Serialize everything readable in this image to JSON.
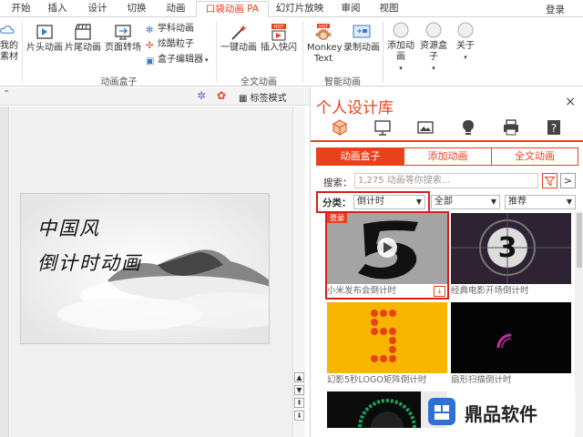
{
  "tabs": [
    "开始",
    "插入",
    "设计",
    "切换",
    "动画",
    "口袋动画 PA",
    "幻灯片放映",
    "审阅",
    "视图"
  ],
  "login": "登录",
  "ribbon": {
    "partial_label_1": "我的",
    "partial_label_2": "素材",
    "btn_intro": "片头动画",
    "btn_outro": "片尾动画",
    "btn_transition": "页面转场",
    "small_subject": "学科动画",
    "small_particles": "炫酷粒子",
    "small_editor": "盒子编辑器",
    "group_box": "动画盒子",
    "btn_oneclick": "一键动画",
    "btn_insert_quick": "插入快闪",
    "group_fulltext": "全文动画",
    "btn_monkey": "Monkey Text",
    "btn_record": "录制动画",
    "group_smart": "智能动画",
    "btn_add_anim": "添加动画",
    "btn_resource": "资源盒子",
    "btn_about": "关于"
  },
  "slide_header": {
    "label_mode": "标签模式"
  },
  "slide": {
    "line1": "中国风",
    "line2": "倒计时动画"
  },
  "panel": {
    "title": "个人设计库",
    "close": "×",
    "tabs": [
      "动画盒子",
      "添加动画",
      "全文动画"
    ],
    "search_label": "搜索：",
    "search_placeholder": "1,275 动画等你搜索...",
    "next": ">",
    "category_label": "分类：",
    "category_value": "倒计时",
    "filter2": "全部",
    "filter3": "推荐",
    "items": [
      {
        "caption": "小米发布会倒计时",
        "badge": "登录"
      },
      {
        "caption": "经典电影开场倒计时"
      },
      {
        "caption": "幻影5秒LOGO矩阵倒计时"
      },
      {
        "caption": "扇形扫描倒计时"
      }
    ]
  },
  "watermark": {
    "text": "鼎品软件"
  },
  "colors": {
    "accent": "#e8421c",
    "highlight": "#d81e1e"
  }
}
